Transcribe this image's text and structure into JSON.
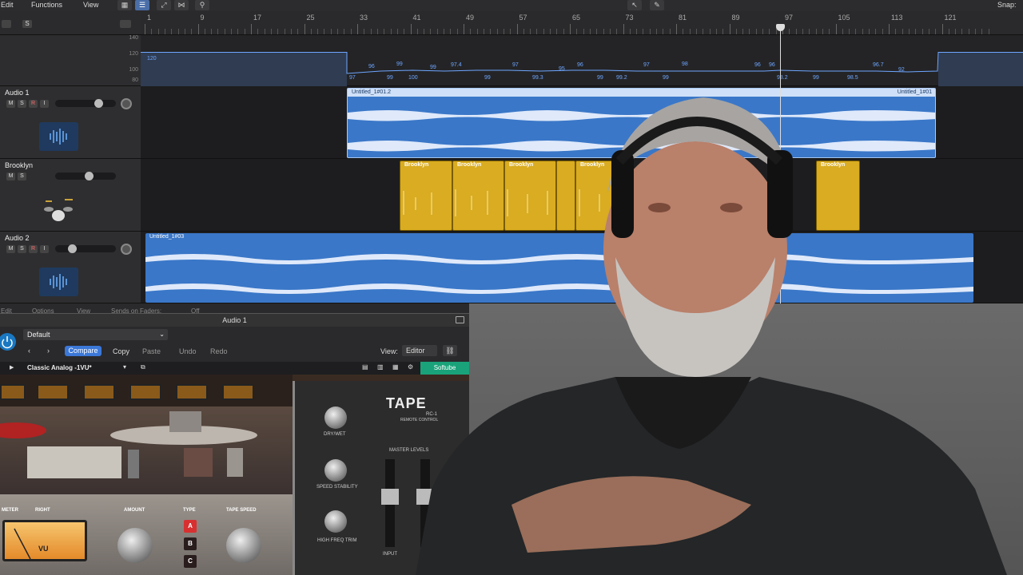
{
  "menubar": {
    "edit": "Edit",
    "functions": "Functions",
    "view": "View",
    "snap": "Snap:"
  },
  "ruler": {
    "bars": [
      "1",
      "9",
      "17",
      "25",
      "33",
      "41",
      "49",
      "57",
      "65",
      "73",
      "81",
      "89",
      "97",
      "105",
      "113",
      "121"
    ]
  },
  "tempo": {
    "scale": [
      "140",
      "120",
      "100",
      "80"
    ],
    "start_value": "120",
    "labels": [
      "97",
      "96",
      "99",
      "99",
      "100",
      "99",
      "97.4",
      "99",
      "97",
      "99.3",
      "95",
      "96",
      "99",
      "99.2",
      "97",
      "99",
      "98",
      "96",
      "96",
      "98.2",
      "99",
      "98.5",
      "96.7",
      "92"
    ]
  },
  "tracks": [
    {
      "name": "Audio 1",
      "buttons": [
        "M",
        "S",
        "R",
        "I"
      ]
    },
    {
      "name": "Brooklyn",
      "buttons": [
        "M",
        "S"
      ]
    },
    {
      "name": "Audio 2",
      "buttons": [
        "M",
        "S",
        "R",
        "I"
      ]
    }
  ],
  "regions": {
    "audio1": "Untitled_1#01.2",
    "audio1_end": "Untitled_1#01",
    "drum": [
      "Brooklyn",
      "Brooklyn",
      "Brooklyn",
      "Brooklyn",
      "Brooklyn"
    ],
    "audio2": "Untitled_1#03"
  },
  "mixer_hint": {
    "edit": "Edit",
    "options": "Options",
    "view": "View",
    "sends": "Sends on Faders:",
    "off": "Off"
  },
  "plugin": {
    "title": "Audio 1",
    "preset": "Default",
    "compare": "Compare",
    "copy": "Copy",
    "paste": "Paste",
    "undo": "Undo",
    "redo": "Redo",
    "view_label": "View:",
    "view_value": "Editor",
    "preset_name": "Classic Analog -1VU*",
    "brand": "Softube",
    "tape_logo": "TAPE",
    "tape_model": "RC-1",
    "tape_sub": "REMOTE CONTROL",
    "dry_wet": "DRY/WET",
    "speed_stability": "SPEED STABILITY",
    "high_freq_trim": "HIGH FREQ TRIM",
    "master_levels": "MASTER LEVELS",
    "input": "INPUT",
    "meter": "METER",
    "right": "RIGHT",
    "amount": "AMOUNT",
    "type": "TYPE",
    "tape_speed": "TAPE SPEED",
    "type_buttons": [
      "A",
      "B",
      "C"
    ],
    "vu": "VU"
  },
  "colors": {
    "audio_region": "#3a77c8",
    "drum_region": "#d9ac21",
    "accent": "#3b78d8",
    "softube": "#1aa37a"
  }
}
